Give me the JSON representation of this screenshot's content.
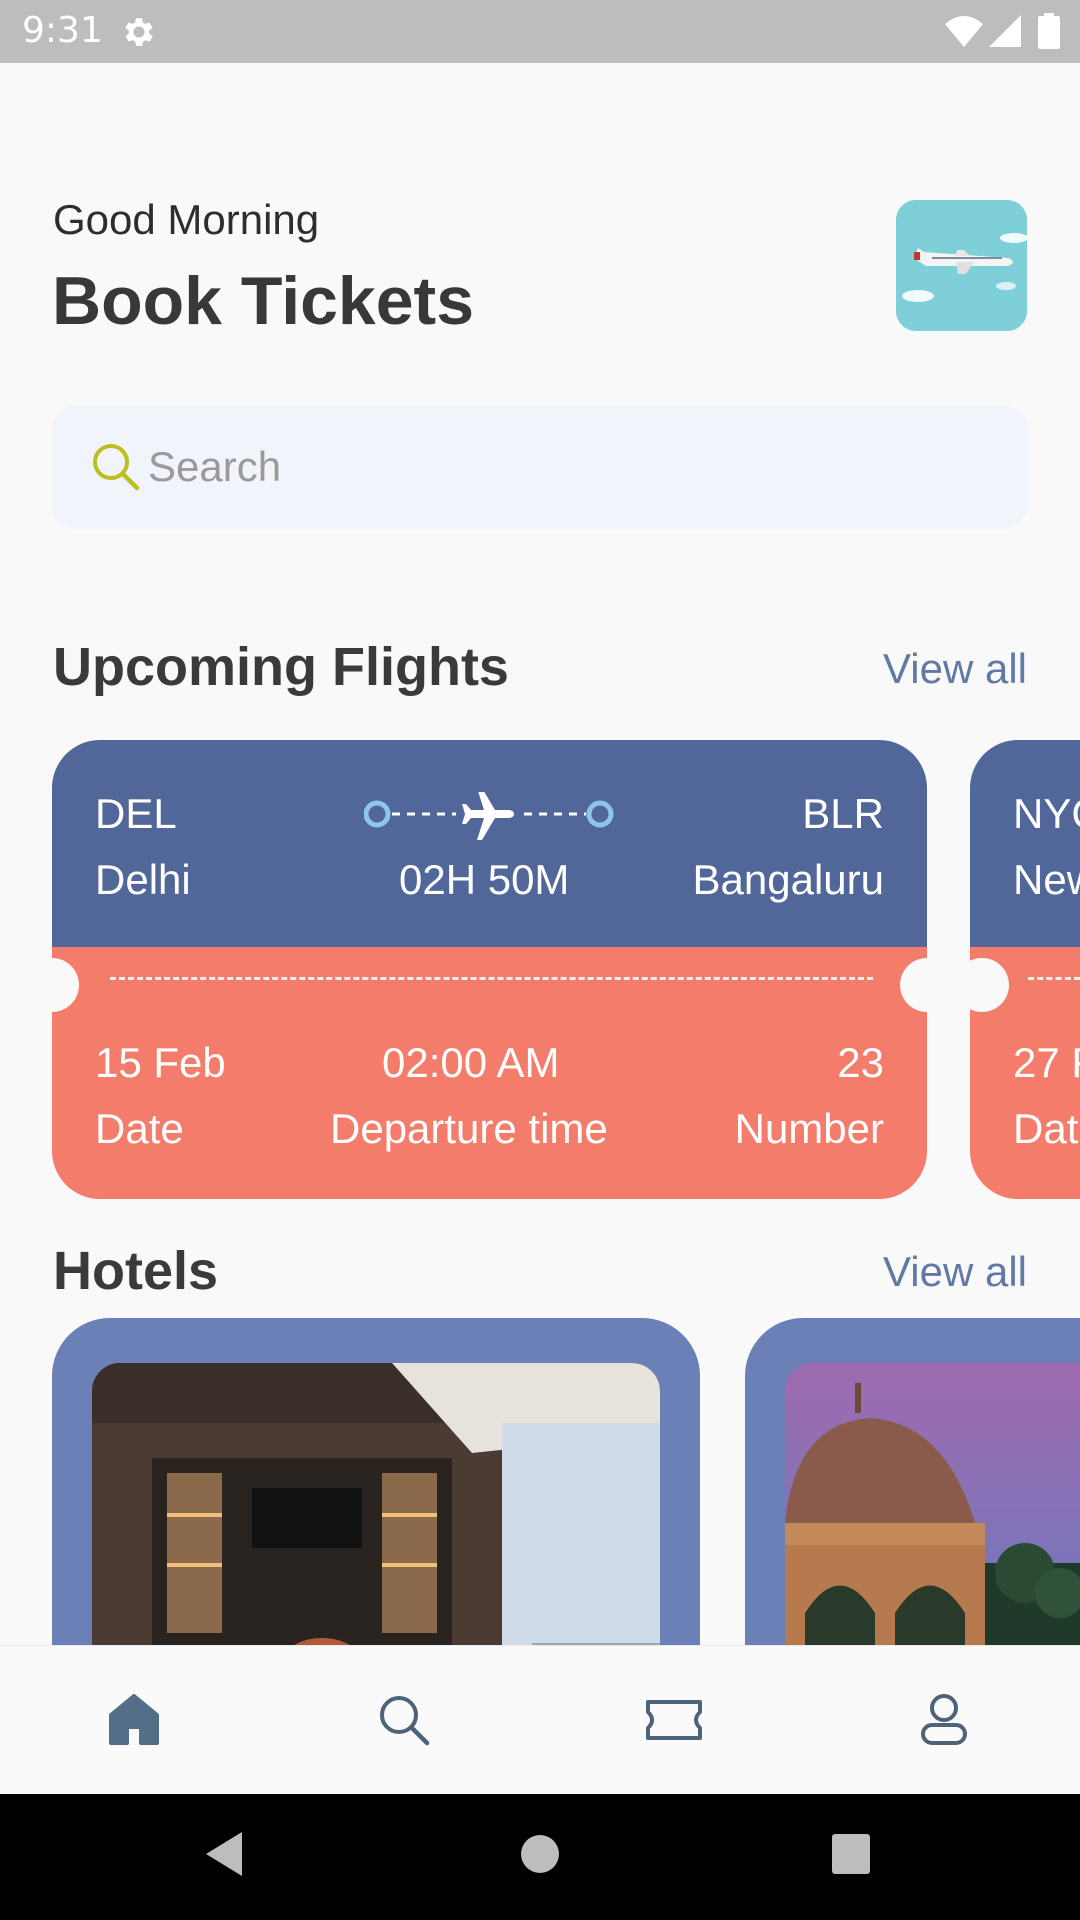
{
  "status_bar": {
    "time": "9:31"
  },
  "header": {
    "greeting": "Good Morning",
    "title": "Book Tickets"
  },
  "search": {
    "placeholder": "Search",
    "value": ""
  },
  "sections": {
    "flights": {
      "title": "Upcoming Flights",
      "view_all": "View all"
    },
    "hotels": {
      "title": "Hotels",
      "view_all": "View all"
    }
  },
  "flights": [
    {
      "from_code": "DEL",
      "from_city": "Delhi",
      "to_code": "BLR",
      "to_city": "Bangaluru",
      "duration": "02H 50M",
      "date": "15 Feb",
      "date_label": "Date",
      "departure": "02:00 AM",
      "departure_label": "Departure time",
      "number": "23",
      "number_label": "Number"
    },
    {
      "from_code": "NYC",
      "from_city": "New",
      "date": "27 F",
      "date_label": "Dat"
    }
  ],
  "colors": {
    "card_top": "#526799",
    "card_bottom": "#f47c6b",
    "hotel_card": "#6b80b7",
    "accent": "#6279a4",
    "nav_active": "#526f87"
  },
  "bottom_nav": [
    {
      "icon": "home-icon",
      "active": true
    },
    {
      "icon": "search-icon",
      "active": false
    },
    {
      "icon": "ticket-icon",
      "active": false
    },
    {
      "icon": "profile-icon",
      "active": false
    }
  ]
}
